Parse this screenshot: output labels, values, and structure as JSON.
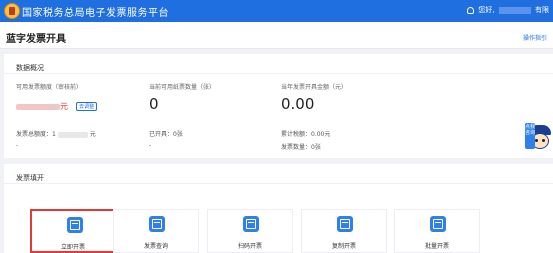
{
  "header": {
    "app_title": "国家税务总局电子发票服务平台",
    "user_prefix": "您好,",
    "user_suffix": "有限"
  },
  "page": {
    "title": "蓝字发票开具",
    "guide_link": "操作指引"
  },
  "stats": {
    "section_title": "数据概况",
    "available_quota_label": "可用发票额度（审核前）",
    "available_quota_unit": "元",
    "adjust_button": "去调整",
    "total_quota_label": "发票总额度：",
    "total_quota_prefix": "1",
    "total_quota_unit": "元",
    "total_quota_dash": "-",
    "usable_count_label": "当前可用纸票数量（张）",
    "usable_count_value": "0",
    "issued_text": "已开具：0张",
    "issued_dash": "-",
    "month_amount_label": "当年发票开具金额（元）",
    "month_amount_value": "0.00",
    "total_tax_text": "累计税额：0.00元",
    "invoice_count_text": "发票数量：0张"
  },
  "mascot": {
    "sign_text": "点我咨询"
  },
  "fill": {
    "section_title": "发票填开",
    "tiles": [
      {
        "label": "立即开票",
        "icon": "invoice-icon",
        "selected": true
      },
      {
        "label": "发票查询",
        "icon": "search-doc-icon",
        "selected": false
      },
      {
        "label": "扫码开票",
        "icon": "qr-icon",
        "selected": false
      },
      {
        "label": "复制开票",
        "icon": "copy-icon",
        "selected": false
      },
      {
        "label": "批量开票",
        "icon": "batch-icon",
        "selected": false
      }
    ]
  },
  "colors": {
    "brand": "#1f6fe0",
    "highlight": "#e53935"
  }
}
